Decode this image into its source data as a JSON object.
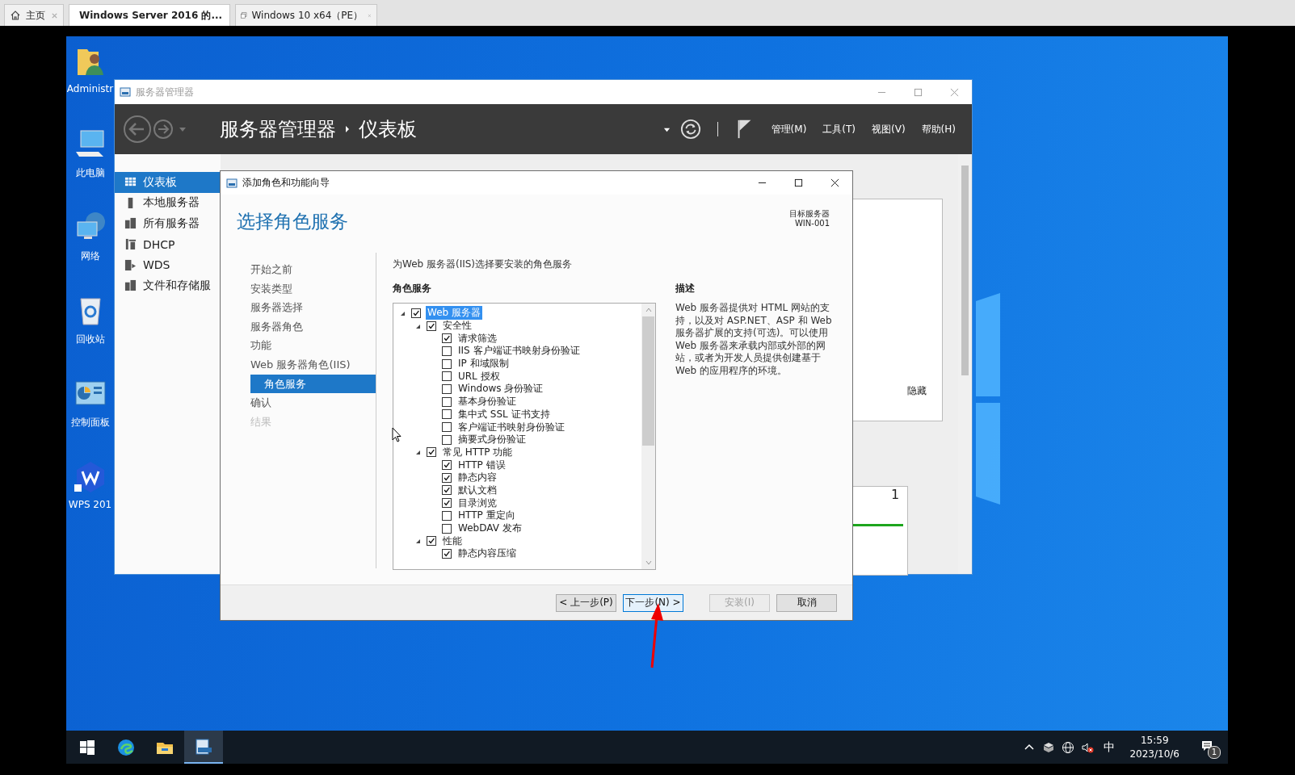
{
  "browser_tabs": [
    {
      "label": "主页",
      "kind": "home",
      "selected": false
    },
    {
      "label": "Windows Server 2016 的...",
      "kind": "vm",
      "selected": true
    },
    {
      "label": "Windows 10 x64（PE）",
      "kind": "window",
      "selected": false
    }
  ],
  "desktop_icons": [
    {
      "label": "Administr",
      "kind": "user"
    },
    {
      "label": "此电脑",
      "kind": "computer"
    },
    {
      "label": "网络",
      "kind": "network"
    },
    {
      "label": "回收站",
      "kind": "recycle"
    },
    {
      "label": "控制面板",
      "kind": "control"
    },
    {
      "label": "WPS 201",
      "kind": "wps"
    }
  ],
  "server_manager": {
    "title": "服务器管理器",
    "breadcrumb": [
      "服务器管理器",
      "仪表板"
    ],
    "menus": [
      "管理(M)",
      "工具(T)",
      "视图(V)",
      "帮助(H)"
    ],
    "sidebar": [
      {
        "label": "仪表板",
        "kind": "dashboard",
        "selected": true
      },
      {
        "label": "本地服务器",
        "kind": "local",
        "selected": false
      },
      {
        "label": "所有服务器",
        "kind": "all",
        "selected": false
      },
      {
        "label": "DHCP",
        "kind": "dhcp",
        "selected": false
      },
      {
        "label": "WDS",
        "kind": "wds",
        "selected": false
      },
      {
        "label": "文件和存储服",
        "kind": "storage",
        "selected": false
      }
    ],
    "hide_link": "隐藏",
    "tile_count": "1"
  },
  "wizard": {
    "title": "添加角色和功能向导",
    "heading": "选择角色服务",
    "target_label": "目标服务器",
    "target_server": "WIN-001",
    "steps": [
      {
        "label": "开始之前",
        "selected": false,
        "disabled": false
      },
      {
        "label": "安装类型",
        "selected": false,
        "disabled": false
      },
      {
        "label": "服务器选择",
        "selected": false,
        "disabled": false
      },
      {
        "label": "服务器角色",
        "selected": false,
        "disabled": false
      },
      {
        "label": "功能",
        "selected": false,
        "disabled": false
      },
      {
        "label": "Web 服务器角色(IIS)",
        "selected": false,
        "disabled": false
      },
      {
        "label": "角色服务",
        "selected": true,
        "disabled": false,
        "sub": true
      },
      {
        "label": "确认",
        "selected": false,
        "disabled": false
      },
      {
        "label": "结果",
        "selected": false,
        "disabled": true
      }
    ],
    "instruction": "为Web 服务器(IIS)选择要安装的角色服务",
    "roles_heading": "角色服务",
    "tree": [
      {
        "label": "Web 服务器",
        "checked": true,
        "expanded": true,
        "selected": true,
        "children": [
          {
            "label": "安全性",
            "checked": true,
            "expanded": true,
            "selected": false,
            "children": [
              {
                "label": "请求筛选",
                "checked": true,
                "selected": false
              },
              {
                "label": "IIS 客户端证书映射身份验证",
                "checked": false,
                "selected": false
              },
              {
                "label": "IP 和域限制",
                "checked": false,
                "selected": false
              },
              {
                "label": "URL 授权",
                "checked": false,
                "selected": false
              },
              {
                "label": "Windows 身份验证",
                "checked": false,
                "selected": false
              },
              {
                "label": "基本身份验证",
                "checked": false,
                "selected": false
              },
              {
                "label": "集中式 SSL 证书支持",
                "checked": false,
                "selected": false
              },
              {
                "label": "客户端证书映射身份验证",
                "checked": false,
                "selected": false
              },
              {
                "label": "摘要式身份验证",
                "checked": false,
                "selected": false
              }
            ]
          },
          {
            "label": "常见 HTTP 功能",
            "checked": true,
            "expanded": true,
            "selected": false,
            "children": [
              {
                "label": "HTTP 错误",
                "checked": true,
                "selected": false
              },
              {
                "label": "静态内容",
                "checked": true,
                "selected": false
              },
              {
                "label": "默认文档",
                "checked": true,
                "selected": false
              },
              {
                "label": "目录浏览",
                "checked": true,
                "selected": false
              },
              {
                "label": "HTTP 重定向",
                "checked": false,
                "selected": false
              },
              {
                "label": "WebDAV 发布",
                "checked": false,
                "selected": false
              }
            ]
          },
          {
            "label": "性能",
            "checked": true,
            "expanded": true,
            "selected": false,
            "children": [
              {
                "label": "静态内容压缩",
                "checked": true,
                "selected": false
              }
            ]
          }
        ]
      }
    ],
    "description_heading": "描述",
    "description": "Web 服务器提供对 HTML 网站的支持，以及对 ASP.NET、ASP 和 Web 服务器扩展的支持(可选)。可以使用 Web 服务器来承载内部或外部的网站，或者为开发人员提供创建基于 Web 的应用程序的环境。",
    "buttons": [
      {
        "label": "< 上一步(P)",
        "default": false,
        "disabled": false
      },
      {
        "label": "下一步(N) >",
        "default": true,
        "disabled": false
      },
      {
        "label": "安装(I)",
        "default": false,
        "disabled": true
      },
      {
        "label": "取消",
        "default": false,
        "disabled": false
      }
    ]
  },
  "taskbar": {
    "apps": [
      {
        "kind": "start",
        "selected": false
      },
      {
        "kind": "edge",
        "selected": false
      },
      {
        "kind": "explorer",
        "selected": false
      },
      {
        "kind": "server",
        "selected": true
      }
    ],
    "ime": "中",
    "time": "15:59",
    "date": "2023/10/6",
    "notification_badge": "1"
  }
}
